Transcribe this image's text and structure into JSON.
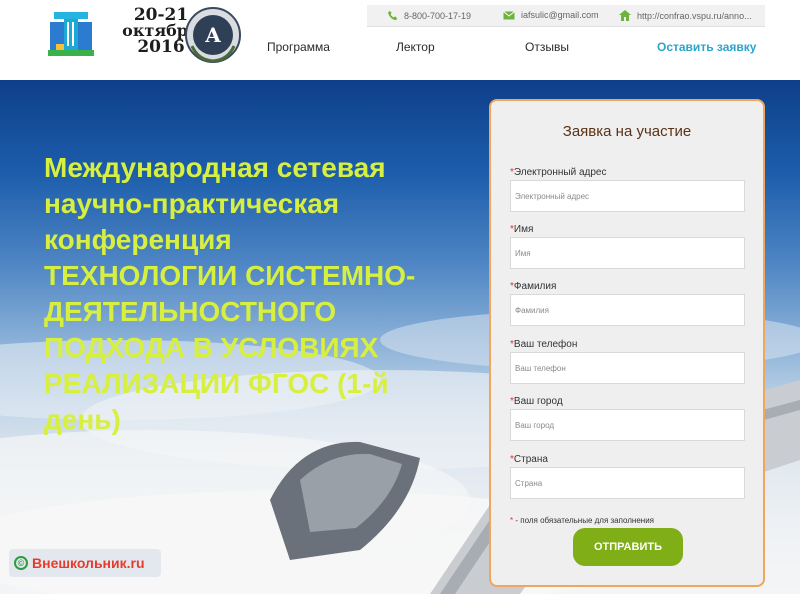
{
  "logo": {
    "date_line1": "20-21",
    "date_line2": "октября",
    "date_line3": "2016",
    "seal_letter": "A"
  },
  "contacts": {
    "phone": "8-800-700-17-19",
    "email": "iafsulic@gmail.com",
    "url": "http://confrao.vspu.ru/anno..."
  },
  "nav": {
    "items": [
      "Программа",
      "Лектор",
      "Отзывы"
    ],
    "cta": "Оставить заявку"
  },
  "hero": {
    "line1": "Международная сетевая",
    "line2": "научно-практическая",
    "line3": "конференция",
    "caps1": "ТЕХНОЛОГИИ СИСТЕМНО-",
    "caps2": "ДЕЯТЕЛЬНОСТНОГО",
    "caps3": "ПОДХОДА В УСЛОВИЯХ",
    "caps4": "РЕАЛИЗАЦИИ ФГОС (1-й",
    "caps5": "день)"
  },
  "form": {
    "title": "Заявка на участие",
    "required_mark": "*",
    "fields": [
      {
        "label": "Электронный адрес",
        "placeholder": "Электронный адрес"
      },
      {
        "label": "Имя",
        "placeholder": "Имя"
      },
      {
        "label": "Фамилия",
        "placeholder": "Фамилия"
      },
      {
        "label": "Ваш телефон",
        "placeholder": "Ваш телефон"
      },
      {
        "label": "Ваш город",
        "placeholder": "Ваш город"
      },
      {
        "label": "Страна",
        "placeholder": "Страна"
      }
    ],
    "note": " - поля обязательные для заполнения",
    "submit_label": "ОТПРАВИТЬ"
  },
  "watermark": {
    "copyright": "©",
    "text": "Внешкольник.ru"
  },
  "colors": {
    "accent_cta": "#2ba5c9",
    "hero_text": "#d7ef3f",
    "form_border": "#f0a65c",
    "submit_bg": "#7fae17",
    "required": "#e53030"
  },
  "icons": {
    "phone": "phone-icon",
    "email": "email-icon",
    "home": "home-icon"
  }
}
